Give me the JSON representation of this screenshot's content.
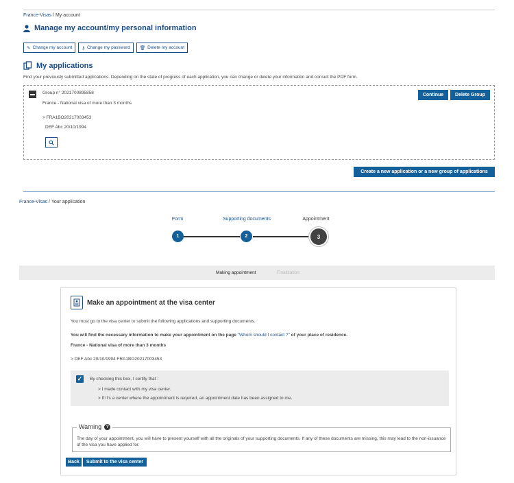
{
  "account_page": {
    "breadcrumb": {
      "root": "France-Visas",
      "sep": " / ",
      "current": "My account"
    },
    "title": "Manage my account/my personal information",
    "buttons": {
      "change_account": "Change my account",
      "change_password": "Change my password",
      "delete_account": "Delete my account"
    },
    "applications": {
      "title": "My applications",
      "intro": "Find your previously submitted applications. Depending on the state of progress of each application, you can change or delete your information and consult the PDF form.",
      "group": {
        "label": "Group n° 2021700895858",
        "visa": "France - National visa of more than 3 months",
        "app_ref": "> FRA1BO20217003453",
        "applicant": "DEF Abc 20/10/1994",
        "continue": "Continue",
        "delete_group": "Delete Group"
      },
      "create_new": "Create a new application or a new group of applications"
    }
  },
  "application_page": {
    "breadcrumb": {
      "root": "France-Visas",
      "sep": " / ",
      "current": "Your application"
    },
    "steps": [
      {
        "label": "Form",
        "number": "1"
      },
      {
        "label": "Supporting documents",
        "number": "2"
      },
      {
        "label": "Appointment",
        "number": "3"
      }
    ],
    "substeps": {
      "active": "Making appointment",
      "inactive": "Finalization"
    },
    "card": {
      "title": "Make an appointment at the visa center",
      "p1": "You must go to the visa center to submit the following applications and supporting documents.",
      "p2_before": "You will find the necessary information to make your appointment on the page ",
      "p2_link": "\"Whom should I contact ?\"",
      "p2_after": " of your place of residence.",
      "visa_title": "France - National visa of more than 3 months",
      "applicant_line": "> DEF Abc 20/10/1994 FRA1BO20217003453",
      "certify": {
        "label": "By checking this box, I certify that :",
        "item1": "> I made contact with my visa center.",
        "item2": "> If it's a center where the appointment is required, an appointment date has been assigned to me."
      },
      "warning": {
        "title": "Warning",
        "text": "The day of your appointment, you will have to present yourself with all the originals of your supporting documents. If any of these documents are missing, this may lead to the non-issuance of the visa you have applied for."
      },
      "back": "Back",
      "submit": "Submit to the visa center"
    }
  },
  "colors": {
    "primary": "#14609a",
    "link": "#1a4e8a",
    "step_current": "#424242"
  }
}
